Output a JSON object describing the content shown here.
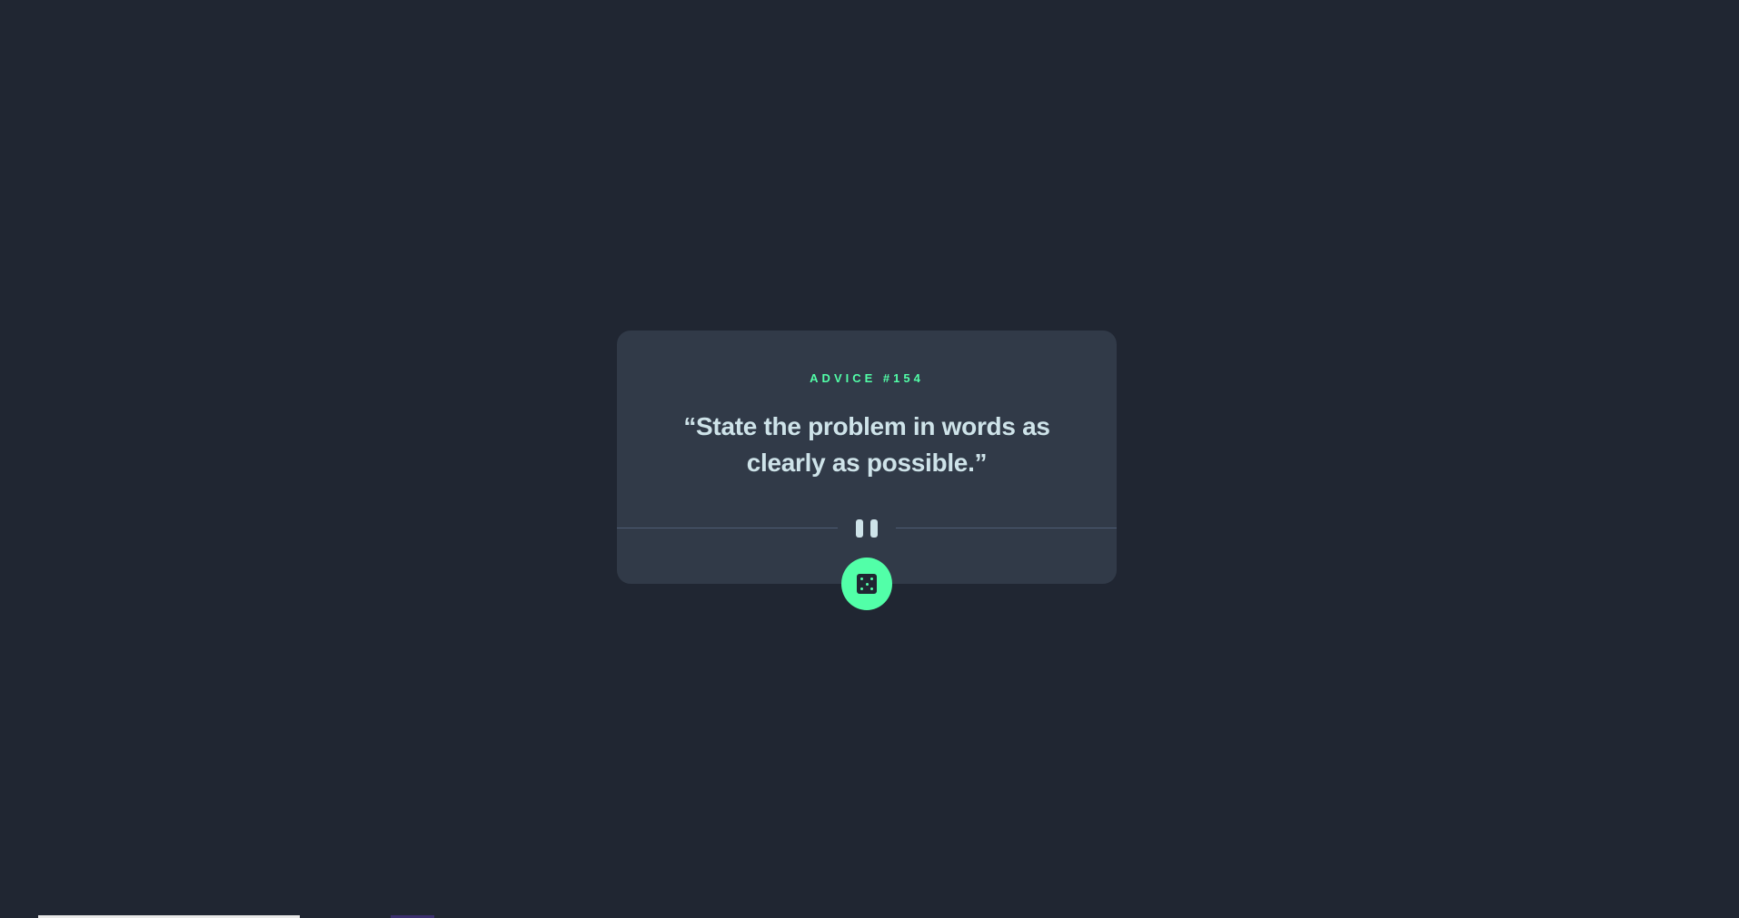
{
  "advice": {
    "label": "ADVICE #154",
    "quote": "“State the problem in words as clearly as possible.”"
  },
  "controls": {
    "generate_button_icon": "dice-icon",
    "divider_icon": "pause-icon"
  },
  "colors": {
    "background": "#202632",
    "card": "#313a48",
    "accent": "#52ffa8",
    "text": "#cee3e9",
    "divider": "#4f5d74"
  }
}
